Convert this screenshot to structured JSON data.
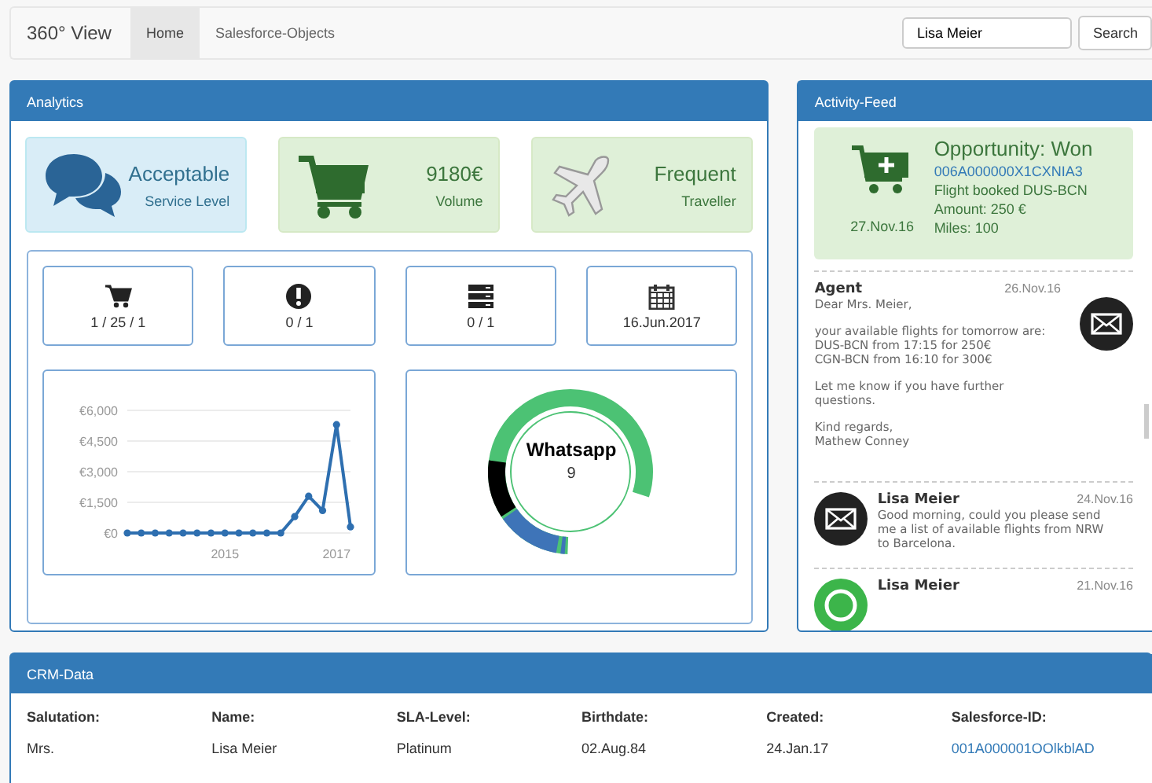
{
  "navbar": {
    "brand": "360° View",
    "tabs": [
      {
        "label": "Home",
        "selected": true
      },
      {
        "label": "Salesforce-Objects",
        "selected": false
      }
    ],
    "search": {
      "value": "Lisa Meier"
    },
    "search_button": "Search"
  },
  "analytics": {
    "title": "Analytics",
    "tiles": [
      {
        "kind": "service",
        "value": "Acceptable",
        "label": "Service Level"
      },
      {
        "kind": "volume",
        "value": "9180€",
        "label": "Volume"
      },
      {
        "kind": "traveller",
        "value": "Frequent",
        "label": "Traveller"
      }
    ],
    "counters": [
      {
        "kind": "cart",
        "text": "1 / 25 / 1"
      },
      {
        "kind": "alert",
        "text": "0 / 1"
      },
      {
        "kind": "server",
        "text": "0 / 1"
      },
      {
        "kind": "calendar",
        "text": "16.Jun.2017"
      }
    ],
    "chart_data": {
      "type": "line",
      "x": [
        2013.25,
        2013.5,
        2013.75,
        2014,
        2014.25,
        2014.5,
        2014.75,
        2015,
        2015.25,
        2015.5,
        2015.75,
        2016,
        2016.25,
        2016.5,
        2016.75,
        2017,
        2017.25
      ],
      "series": [
        {
          "color": "#2e6fb0",
          "marker": true,
          "values": [
            0,
            0,
            0,
            0,
            0,
            0,
            0,
            0,
            0,
            0,
            0,
            0,
            800,
            1800,
            1100,
            5300,
            300
          ]
        }
      ],
      "xlim": [
        2013.25,
        2017.25
      ],
      "ylim": [
        0,
        6000
      ],
      "grid": true,
      "xticks": [
        2015,
        2017
      ],
      "yticks": [
        {
          "value": 0,
          "label": "€0"
        },
        {
          "value": 1500,
          "label": "€1,500"
        },
        {
          "value": 3000,
          "label": "€3,000"
        },
        {
          "value": 4500,
          "label": "€4,500"
        },
        {
          "value": 6000,
          "label": "€6,000"
        }
      ]
    },
    "donut": {
      "label": "Whatsapp",
      "count": "9"
    }
  },
  "feed": {
    "title": "Activity-Feed",
    "items": [
      {
        "kind": "opportunity",
        "title": "Opportunity: Won",
        "link": "006A000000X1CXNIA3",
        "lines": [
          "Flight booked DUS-BCN",
          "Amount: 250 €",
          "Miles: 100"
        ],
        "date": "27.Nov.16"
      },
      {
        "kind": "email-out",
        "sender": "Agent",
        "date": "26.Nov.16",
        "paragraphs": [
          "Dear Mrs. Meier,",
          "your available flights for tomorrow are:\nDUS-BCN from 17:15 for 250€\nCGN-BCN from 16:10 for 300€",
          "Let me know if you have further\nquestions.",
          "Kind regards,\nMathew Conney"
        ]
      },
      {
        "kind": "email-in",
        "sender": "Lisa Meier",
        "date": "24.Nov.16",
        "paragraphs": [
          "Good morning, could you please send\nme a list of available flights from NRW\nto Barcelona."
        ]
      },
      {
        "kind": "whatsapp",
        "sender": "Lisa Meier",
        "date": "21.Nov.16"
      }
    ]
  },
  "crm": {
    "title": "CRM-Data",
    "columns": [
      {
        "label": "Salutation:",
        "value": "Mrs.",
        "kind": "text"
      },
      {
        "label": "Name:",
        "value": "Lisa Meier",
        "kind": "text"
      },
      {
        "label": "SLA-Level:",
        "value": "Platinum",
        "kind": "text"
      },
      {
        "label": "Birthdate:",
        "value": "02.Aug.84",
        "kind": "text"
      },
      {
        "label": "Created:",
        "value": "24.Jan.17",
        "kind": "text"
      },
      {
        "label": "Salesforce-ID:",
        "value": "001A000001OOlkblAD",
        "kind": "link"
      }
    ]
  }
}
